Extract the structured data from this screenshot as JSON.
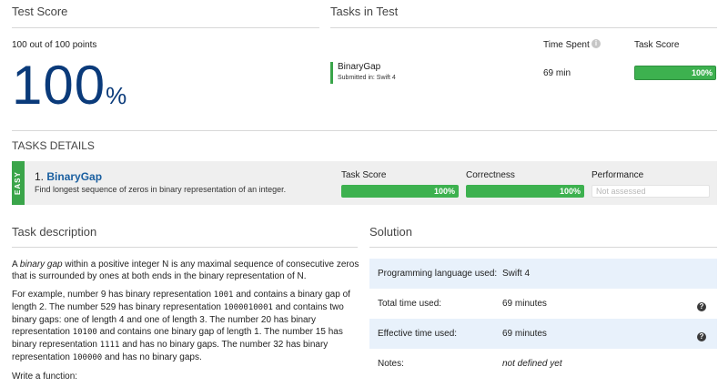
{
  "test_score": {
    "title": "Test Score",
    "points_text": "100 out of 100 points",
    "percent_value": "100",
    "percent_sign": "%"
  },
  "tasks_in_test": {
    "title": "Tasks in Test",
    "col_time_spent": "Time Spent",
    "col_task_score": "Task Score",
    "task": {
      "name": "BinaryGap",
      "submitted": "Submitted in: Swift 4",
      "time": "69 min",
      "score_label": "100%",
      "score_fraction": 1.0
    }
  },
  "tasks_details": {
    "title": "TASKS DETAILS",
    "difficulty": "EASY",
    "number": "1.",
    "name": "BinaryGap",
    "summary": "Find longest sequence of zeros in binary representation of an integer.",
    "col_task_score": "Task Score",
    "col_correctness": "Correctness",
    "col_performance": "Performance",
    "task_score_label": "100%",
    "correctness_label": "100%",
    "performance_label": "Not assessed"
  },
  "task_description": {
    "title": "Task description",
    "p1_a": "A ",
    "p1_em": "binary gap",
    "p1_b": " within a positive integer N is any maximal sequence of consecutive zeros that is surrounded by ones at both ends in the binary representation of N.",
    "p2_1": "For example, number 9 has binary representation ",
    "p2_c1": "1001",
    "p2_2": " and contains a binary gap of length 2. The number 529 has binary representation ",
    "p2_c2": "1000010001",
    "p2_3": " and contains two binary gaps: one of length 4 and one of length 3. The number 20 has binary representation ",
    "p2_c3": "10100",
    "p2_4": " and contains one binary gap of length 1. The number 15 has binary representation ",
    "p2_c4": "1111",
    "p2_5": " and has no binary gaps. The number 32 has binary representation ",
    "p2_c5": "100000",
    "p2_6": " and has no binary gaps.",
    "p3": "Write a function:"
  },
  "solution": {
    "title": "Solution",
    "rows": [
      {
        "key": "Programming language used:",
        "value": "Swift 4"
      },
      {
        "key": "Total time used:",
        "value": "69 minutes"
      },
      {
        "key": "Effective time used:",
        "value": "69 minutes"
      },
      {
        "key": "Notes:",
        "value": "not defined yet"
      }
    ]
  },
  "icons": {
    "info": "info-icon",
    "help": "help-icon"
  }
}
